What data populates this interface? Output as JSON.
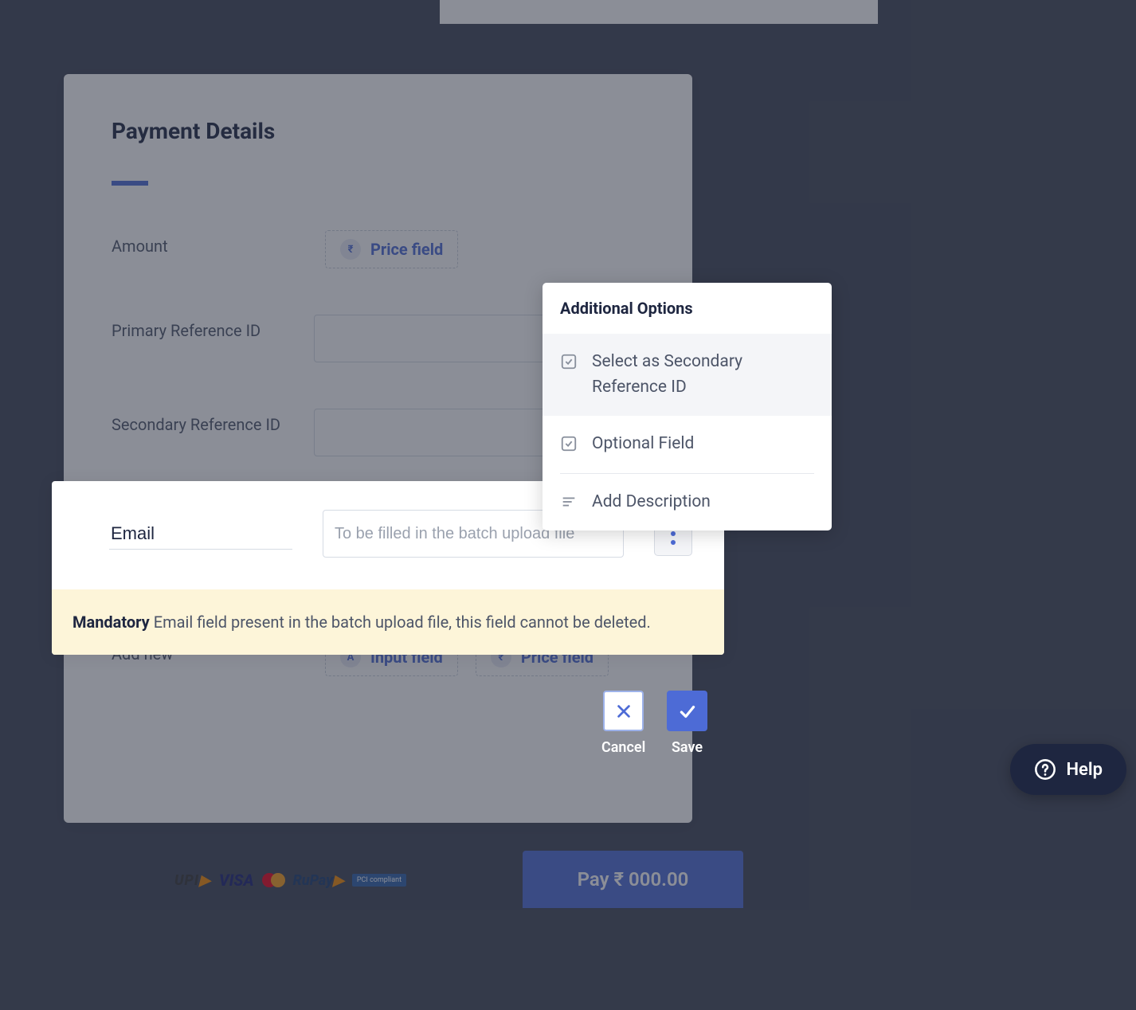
{
  "section_title": "Payment Details",
  "fields": {
    "amount_label": "Amount",
    "price_chip": "Price field",
    "primary_ref_label": "Primary Reference ID",
    "secondary_ref_label": "Secondary Reference ID",
    "addnew_label": "Add new",
    "input_chip": "Input field",
    "price_chip2": "Price field"
  },
  "editor": {
    "label_value": "Email",
    "placeholder": "To be filled in the batch upload file",
    "alert_strong": "Mandatory",
    "alert_text": " Email field present in the batch upload file, this field cannot be deleted."
  },
  "popover": {
    "title": "Additional Options",
    "item1": "Select as Secondary Reference ID",
    "item2": "Optional Field",
    "item3": "Add Description"
  },
  "actions": {
    "cancel": "Cancel",
    "save": "Save"
  },
  "pay_button": "Pay  ₹ 000.00",
  "brands": {
    "upi": "UPI",
    "visa": "VISA",
    "rupay": "RuPay",
    "pci": "PCI compliant"
  },
  "help": "Help",
  "icons": {
    "rupee": "₹",
    "letter_a": "A"
  }
}
